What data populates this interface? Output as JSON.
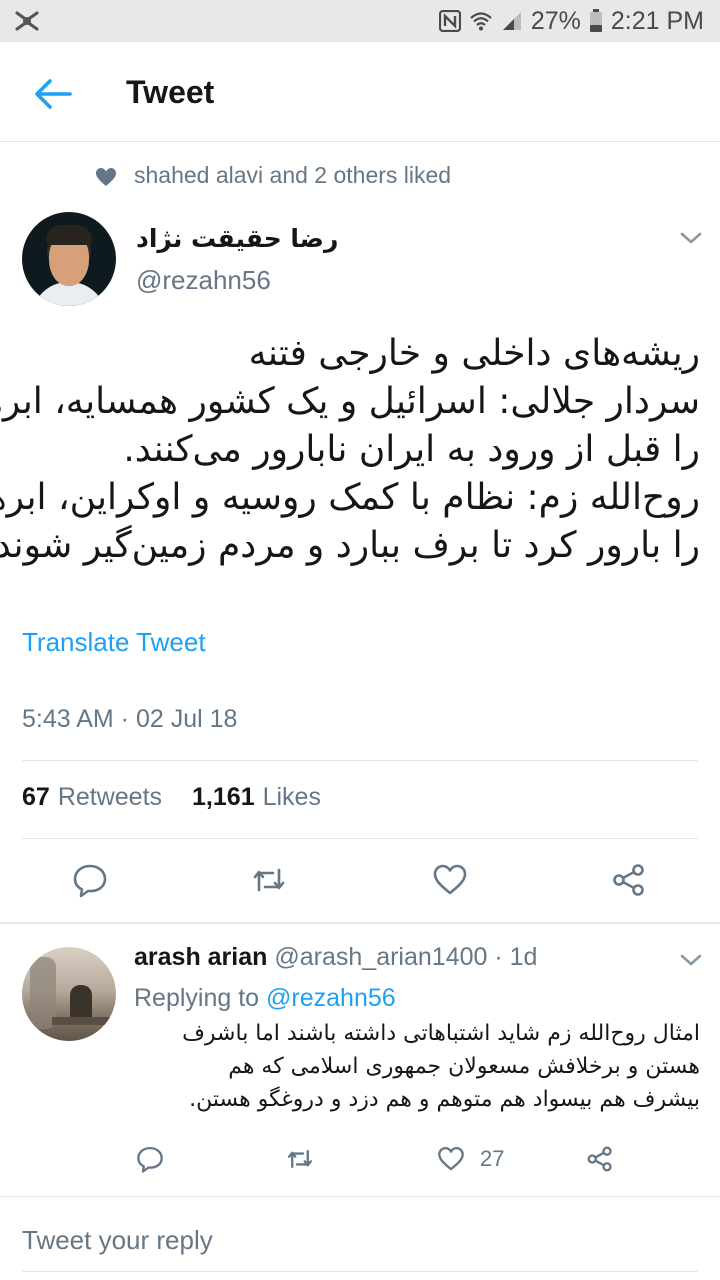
{
  "status_bar": {
    "battery": "27%",
    "time": "2:21 PM",
    "icons": [
      "app-notification-icon",
      "nfc-icon",
      "wifi-icon",
      "signal-icon",
      "battery-icon"
    ]
  },
  "app_bar": {
    "title": "Tweet",
    "back_icon": "arrow-left-icon"
  },
  "social_context": {
    "text": "shahed alavi and 2 others liked",
    "icon": "heart-icon"
  },
  "tweet": {
    "author_name": "رضا حقیقت نژاد",
    "author_handle": "@rezahn56",
    "text_lines": [
      "ریشه‌های داخلی و خارجی فتنه",
      "سردار جلالی: اسرائیل و یک کشور همسایه، ابرها",
      "را قبل از ورود به ایران نابارور می‌کنند.",
      "روح‌الله زم: نظام با کمک روسیه و اوکراین، ابرها",
      "را بارور کرد تا برف ببارد و مردم زمین‌گیر شوند."
    ],
    "translate_label": "Translate Tweet",
    "timestamp": "5:43 AM · 02 Jul 18",
    "retweets_count": "67",
    "retweets_label": "Retweets",
    "likes_count": "1,161",
    "likes_label": "Likes"
  },
  "reply": {
    "author_name": "arash arian",
    "author_handle": "@arash_arian1400",
    "time": "· 1d",
    "replying_label": "Replying to",
    "replying_handle": "@rezahn56",
    "text_lines": [
      "امثال روح‌الله زم شاید اشتباهاتی داشته باشند اما باشرف",
      "هستن و برخلافش مسعولان جمهوری اسلامی که هم",
      "بیشرف هم بیسواد هم متوهم و هم دزد و دروغگو هستن."
    ],
    "like_count": "27"
  },
  "compose": {
    "placeholder": "Tweet your reply"
  },
  "colors": {
    "accent": "#1da1f2",
    "secondary_text": "#657786",
    "primary_text": "#14171a",
    "divider": "#e1e8ed"
  }
}
